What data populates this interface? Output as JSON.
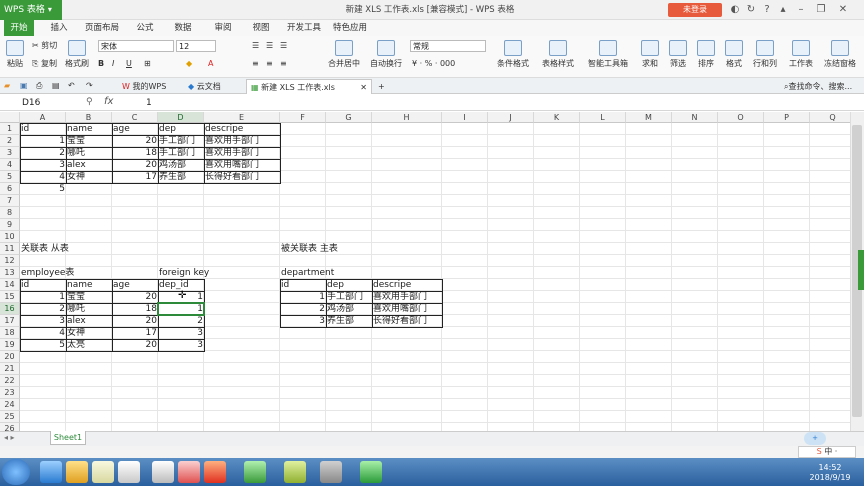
{
  "app": {
    "brand": "WPS 表格",
    "title": "新建 XLS 工作表.xls [兼容模式] - WPS 表格",
    "login": "未登录"
  },
  "menu": [
    "开始",
    "插入",
    "页面布局",
    "公式",
    "数据",
    "审阅",
    "视图",
    "开发工具",
    "特色应用"
  ],
  "ribbon": {
    "paste": "粘贴",
    "cut": "剪切",
    "copy": "复制",
    "format_painter": "格式刷",
    "font": "宋体",
    "font_size": "12",
    "merge": "合并居中",
    "wrap": "自动换行",
    "number_format": "常规",
    "cond_format": "条件格式",
    "table_style": "表格样式",
    "smart_tools": "智能工具箱",
    "sum": "求和",
    "filter": "筛选",
    "sort": "排序",
    "format": "格式",
    "row_col": "行和列",
    "sheet": "工作表",
    "freeze": "冻结窗格"
  },
  "doctabs": [
    "我的WPS",
    "云文档",
    "新建 XLS 工作表.xls"
  ],
  "search_cmd": "查找命令、搜索...",
  "formula_bar": {
    "name_box": "D16",
    "fx": "fx",
    "value": "1"
  },
  "columns": [
    "A",
    "B",
    "C",
    "D",
    "E",
    "F",
    "G",
    "H",
    "I",
    "J",
    "K",
    "L",
    "M",
    "N",
    "O",
    "P",
    "Q"
  ],
  "rows": [
    "1",
    "2",
    "3",
    "4",
    "5",
    "6",
    "7",
    "8",
    "9",
    "10",
    "11",
    "12",
    "13",
    "14",
    "15",
    "16",
    "17",
    "18",
    "19",
    "20",
    "21",
    "22",
    "23",
    "24",
    "25",
    "26"
  ],
  "selected": {
    "col": "D",
    "row": "16"
  },
  "table1": {
    "header": [
      "id",
      "name",
      "age",
      "dep",
      "descripe"
    ],
    "rows": [
      [
        "1",
        "莹莹",
        "20",
        "手工部门",
        "喜欢用手部门"
      ],
      [
        "2",
        "哪吒",
        "18",
        "手工部门",
        "喜欢用手部门"
      ],
      [
        "3",
        "alex",
        "20",
        "鸡汤部",
        "喜欢用嘴部门"
      ],
      [
        "4",
        "女神",
        "17",
        "养生部",
        "长得好看部门"
      ]
    ],
    "extra_id": "5"
  },
  "labels": {
    "left_title": "关联表 从表",
    "right_title": "被关联表 主表",
    "employee": "employee表",
    "foreign_key": "foreign key",
    "department": "department"
  },
  "employee": {
    "header": [
      "id",
      "name",
      "age",
      "dep_id"
    ],
    "rows": [
      [
        "1",
        "莹莹",
        "20",
        "1"
      ],
      [
        "2",
        "哪吒",
        "18",
        "1"
      ],
      [
        "3",
        "alex",
        "20",
        "2"
      ],
      [
        "4",
        "女神",
        "17",
        "3"
      ],
      [
        "5",
        "太亮",
        "20",
        "3"
      ]
    ]
  },
  "department_tbl": {
    "header": [
      "id",
      "dep",
      "descripe"
    ],
    "rows": [
      [
        "1",
        "手工部门",
        "喜欢用手部门"
      ],
      [
        "2",
        "鸡汤部",
        "喜欢用嘴部门"
      ],
      [
        "3",
        "养生部",
        "长得好看部门"
      ]
    ]
  },
  "sheet_tab": "Sheet1",
  "ime": "中",
  "clock": {
    "time": "14:52",
    "date": "2018/9/19"
  }
}
